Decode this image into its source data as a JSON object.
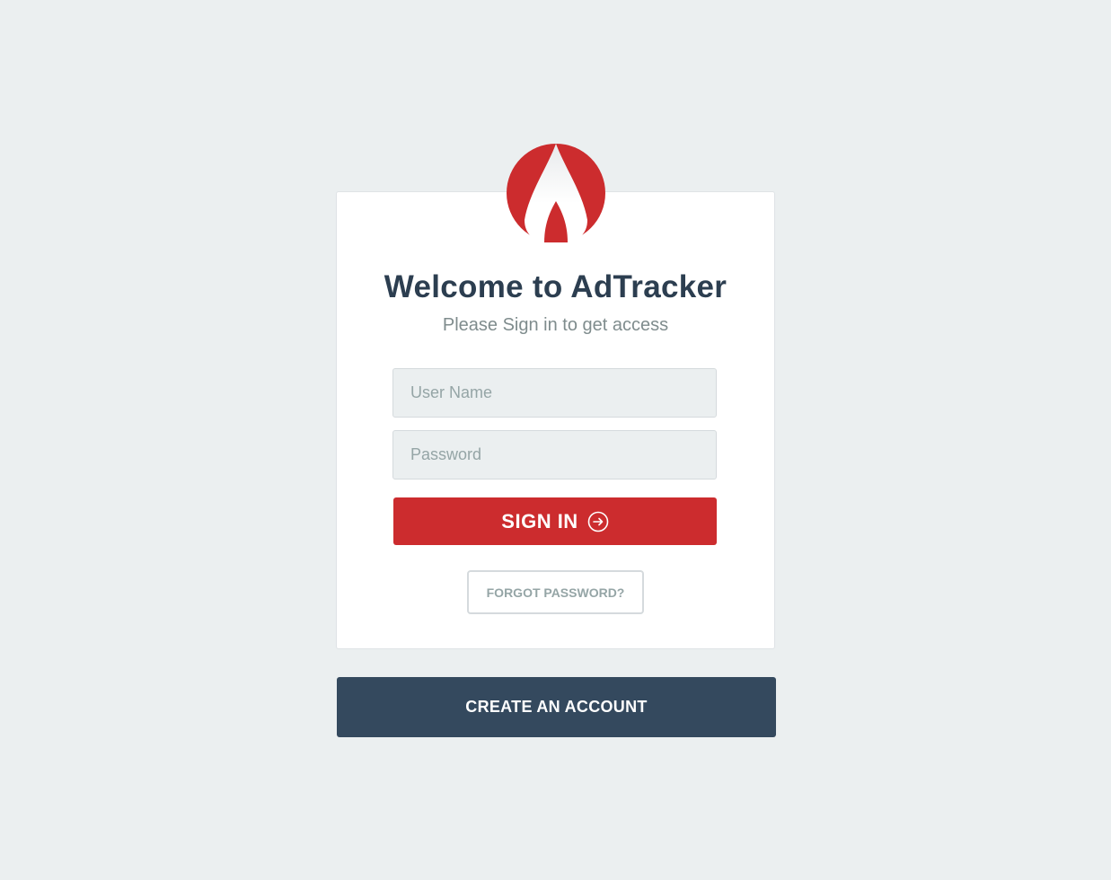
{
  "brand": {
    "logo_icon": "flame-logo-icon",
    "accent_color": "#cc2c2e",
    "dark_color": "#34495e"
  },
  "login": {
    "title": "Welcome to AdTracker",
    "subtitle": "Please Sign in to get access",
    "username_placeholder": "User Name",
    "username_value": "",
    "password_placeholder": "Password",
    "password_value": "",
    "signin_label": "SIGN IN",
    "signin_icon": "arrow-right-circle-icon",
    "forgot_label": "FORGOT PASSWORD?"
  },
  "footer": {
    "create_account_label": "CREATE AN ACCOUNT"
  }
}
